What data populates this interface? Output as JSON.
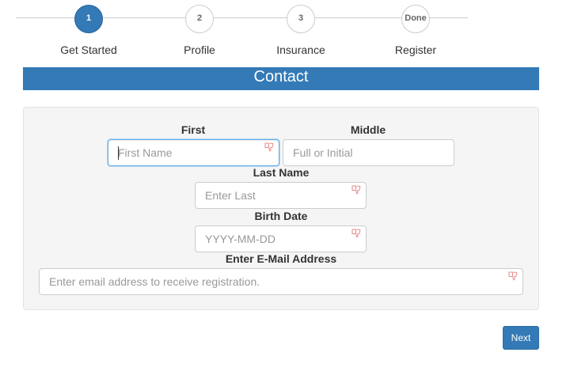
{
  "stepper": {
    "steps": [
      {
        "number": "1",
        "label": "Get Started",
        "active": true
      },
      {
        "number": "2",
        "label": "Profile",
        "active": false
      },
      {
        "number": "3",
        "label": "Insurance",
        "active": false
      },
      {
        "number": "Done",
        "label": "Register",
        "active": false
      }
    ]
  },
  "section": {
    "title": "Contact"
  },
  "form": {
    "first": {
      "label": "First",
      "placeholder": "First Name",
      "value": "",
      "required": true,
      "focused": true
    },
    "middle": {
      "label": "Middle",
      "placeholder": "Full or Initial",
      "value": "",
      "required": false
    },
    "last": {
      "label": "Last Name",
      "placeholder": "Enter Last",
      "value": "",
      "required": true
    },
    "birth": {
      "label": "Birth Date",
      "placeholder": "YYYY-MM-DD",
      "value": "",
      "required": true
    },
    "email": {
      "label": "Enter E-Mail Address",
      "placeholder": "Enter email address to receive registration.",
      "value": "",
      "required": true
    }
  },
  "actions": {
    "next_label": "Next"
  },
  "colors": {
    "primary": "#337ab7",
    "panel_bg": "#f5f5f5",
    "required_icon": "#f4a0a0"
  },
  "icons": {
    "required": "thumbs-down-icon"
  }
}
